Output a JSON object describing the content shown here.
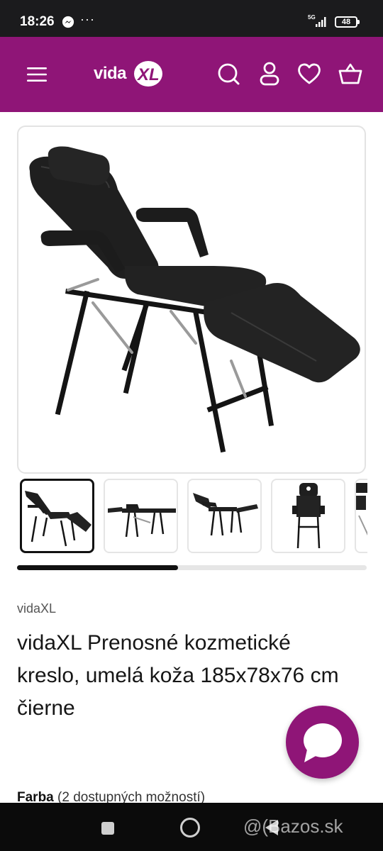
{
  "status_bar": {
    "time": "18:26",
    "dots": "···",
    "network": "5G",
    "battery": "48"
  },
  "header": {
    "logo_text": "vidaXL",
    "background": "#8f1577",
    "icons": [
      "menu-icon",
      "search-icon",
      "account-icon",
      "wishlist-heart-icon",
      "cart-basket-icon"
    ]
  },
  "gallery": {
    "main_image": "reclining-cosmetic-chair-black",
    "thumbnails": [
      "chair-angled-view",
      "chair-flat-side-view",
      "chair-partial-recline-side-view",
      "chair-front-view",
      "chair-next-view"
    ],
    "active_thumbnail_index": 0,
    "scroll_progress": 0.46
  },
  "product": {
    "brand": "vidaXL",
    "title": "vidaXL Prenosné kozmetické kreslo, umelá koža 185x78x76 cm čierne",
    "color_label": "Farba",
    "color_options_text": "(2 dostupných možností)"
  },
  "chat": {
    "icon": "chat-bubble-icon"
  },
  "watermark": "@(Bazos.sk"
}
